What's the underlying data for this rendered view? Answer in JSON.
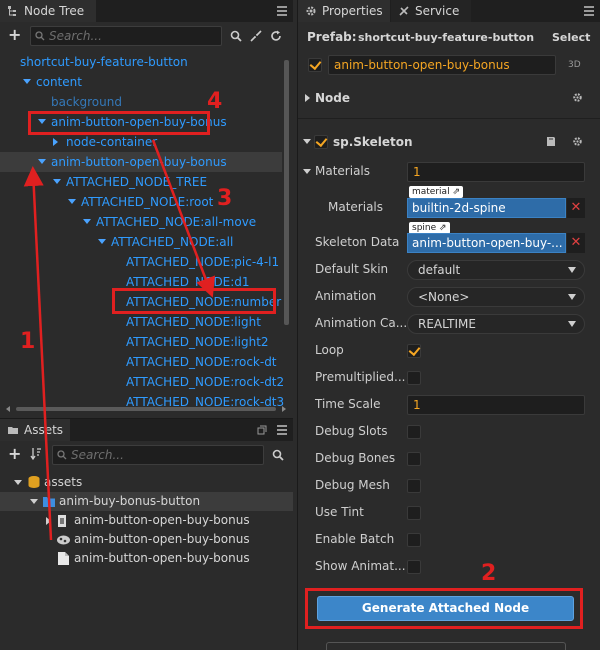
{
  "node_tree": {
    "tab_label": "Node Tree",
    "search_placeholder": "Search...",
    "nodes": [
      {
        "label": "shortcut-buy-feature-button"
      },
      {
        "label": "content"
      },
      {
        "label": "background"
      },
      {
        "label": "anim-button-open-buy-bonus"
      },
      {
        "label": "node-container"
      },
      {
        "label": "anim-button-open-buy-bonus"
      },
      {
        "label": "ATTACHED_NODE_TREE"
      },
      {
        "label": "ATTACHED_NODE:root"
      },
      {
        "label": "ATTACHED_NODE:all-move"
      },
      {
        "label": "ATTACHED_NODE:all"
      },
      {
        "label": "ATTACHED_NODE:pic-4-l1"
      },
      {
        "label": "ATTACHED_NODE:d1"
      },
      {
        "label": "ATTACHED_NODE:number"
      },
      {
        "label": "ATTACHED_NODE:light"
      },
      {
        "label": "ATTACHED_NODE:light2"
      },
      {
        "label": "ATTACHED_NODE:rock-dt"
      },
      {
        "label": "ATTACHED_NODE:rock-dt2"
      },
      {
        "label": "ATTACHED_NODE:rock-dt3"
      }
    ]
  },
  "assets": {
    "tab_label": "Assets",
    "search_placeholder": "Search...",
    "items": [
      {
        "label": "assets"
      },
      {
        "label": "anim-buy-bonus-button"
      },
      {
        "label": "anim-button-open-buy-bonus"
      },
      {
        "label": "anim-button-open-buy-bonus"
      },
      {
        "label": "anim-button-open-buy-bonus"
      }
    ]
  },
  "properties": {
    "tab_label": "Properties",
    "service_tab_label": "Service",
    "prefab_label": "Prefab:",
    "prefab_name": "shortcut-buy-feature-button",
    "select_label": "Select",
    "node_name": "anim-button-open-buy-bonus",
    "mode_3d": "3D",
    "node_section": "Node",
    "component_section": "sp.Skeleton",
    "materials_group_label": "Materials",
    "materials_count": "1",
    "materials_label": "Materials",
    "material_tag": "material",
    "material_value": "builtin-2d-spine",
    "skeleton_data_label": "Skeleton Data",
    "spine_tag": "spine",
    "skeleton_data_value": "anim-button-open-buy-...",
    "default_skin_label": "Default Skin",
    "default_skin_value": "default",
    "animation_label": "Animation",
    "animation_value": "<None>",
    "animation_cache_label": "Animation Ca...",
    "animation_cache_value": "REALTIME",
    "loop_label": "Loop",
    "loop_checked": true,
    "premultiplied_label": "Premultiplied...",
    "time_scale_label": "Time Scale",
    "time_scale_value": "1",
    "debug_slots_label": "Debug Slots",
    "debug_bones_label": "Debug Bones",
    "debug_mesh_label": "Debug Mesh",
    "use_tint_label": "Use Tint",
    "enable_batch_label": "Enable Batch",
    "show_animation_label": "Show Animat...",
    "generate_button_label": "Generate Attached Node"
  },
  "annotations": {
    "n1": "1",
    "n2": "2",
    "n3": "3",
    "n4": "4",
    "color": "#e02020"
  },
  "colors": {
    "accent_blue": "#2f9bff",
    "button_blue": "#3c86c9",
    "check_orange": "#f5a623",
    "panel_bg": "#2b2b2b"
  }
}
